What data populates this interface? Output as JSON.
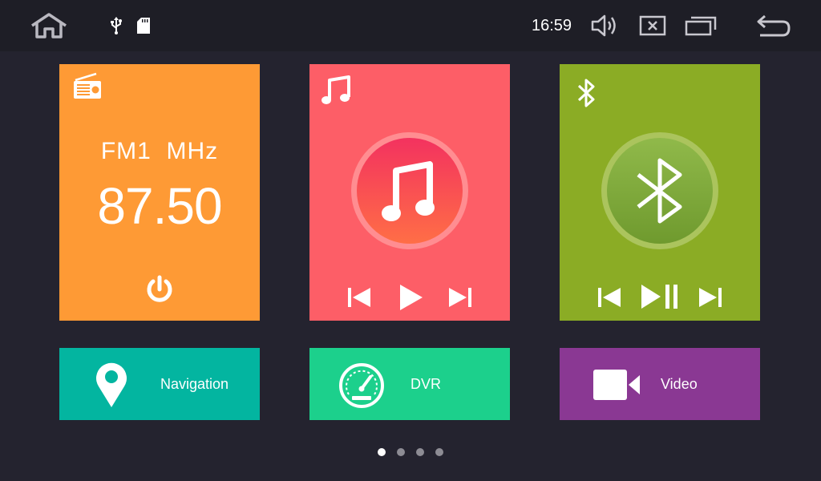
{
  "statusbar": {
    "time": "16:59",
    "icons": [
      "home-icon",
      "usb-icon",
      "sd-card-icon",
      "volume-icon",
      "close-window-icon",
      "recent-apps-icon",
      "back-icon"
    ]
  },
  "radio": {
    "icon": "radio-icon",
    "band_label": "FM1  MHz",
    "frequency": "87.50",
    "power_icon": "power-icon",
    "color": "#fe9a35"
  },
  "music": {
    "icon": "music-note-icon",
    "controls": [
      "previous-icon",
      "play-icon",
      "next-icon"
    ],
    "color": "#fd5e67"
  },
  "bluetooth": {
    "icon": "bluetooth-icon",
    "controls": [
      "previous-icon",
      "play-pause-icon",
      "next-icon"
    ],
    "color": "#8bac25"
  },
  "shortcuts": {
    "navigation": {
      "label": "Navigation",
      "icon": "map-pin-icon",
      "color": "#03b5a0"
    },
    "dvr": {
      "label": "DVR",
      "icon": "speedometer-icon",
      "color": "#1cd08c"
    },
    "video": {
      "label": "Video",
      "icon": "video-camera-icon",
      "color": "#8a3893"
    }
  },
  "pager": {
    "pages": 4,
    "current": 1
  }
}
